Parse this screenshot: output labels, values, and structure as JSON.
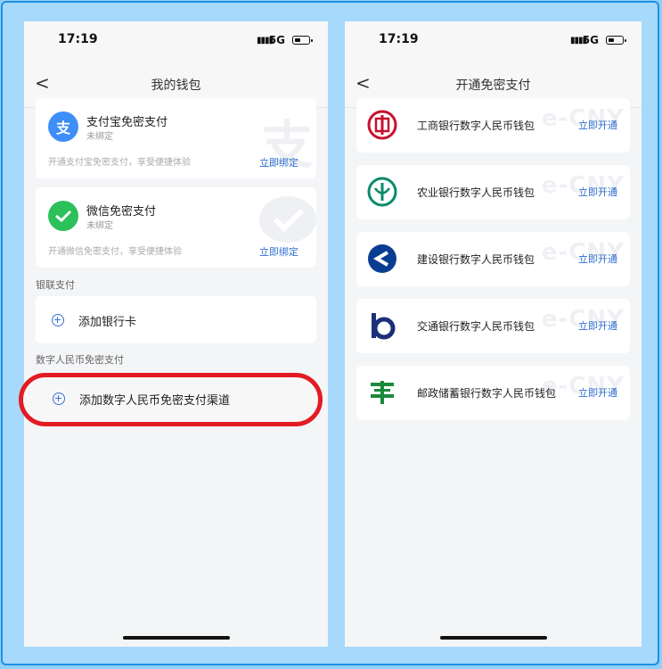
{
  "left": {
    "status": {
      "time": "17:19",
      "network": "5G"
    },
    "nav": {
      "back": "<",
      "title": "我的钱包"
    },
    "alipay": {
      "title": "支付宝免密支付",
      "status": "未绑定",
      "desc": "开通支付宝免密支付，享受便捷体验",
      "link": "立即绑定",
      "icon_char": "支",
      "watermark": "支"
    },
    "wechat": {
      "title": "微信免密支付",
      "status": "未绑定",
      "desc": "开通微信免密支付，享受便捷体验",
      "link": "立即绑定"
    },
    "unionpay_section": "银联支付",
    "add_card": "添加银行卡",
    "ecny_section": "数字人民币免密支付",
    "add_ecny": "添加数字人民币免密支付渠道"
  },
  "right": {
    "status": {
      "time": "17:19",
      "network": "5G"
    },
    "nav": {
      "back": "<",
      "title": "开通免密支付"
    },
    "watermark": "e-CNY",
    "banks": [
      {
        "name": "工商银行数字人民币钱包",
        "link": "立即开通",
        "logo": "icbc-logo",
        "color": "#c8102e"
      },
      {
        "name": "农业银行数字人民币钱包",
        "link": "立即开通",
        "logo": "abc-logo",
        "color": "#0a8a6a"
      },
      {
        "name": "建设银行数字人民币钱包",
        "link": "立即开通",
        "logo": "ccb-logo",
        "color": "#0a3d91"
      },
      {
        "name": "交通银行数字人民币钱包",
        "link": "立即开通",
        "logo": "bocom-logo",
        "color": "#1b2f7a"
      },
      {
        "name": "邮政储蓄银行数字人民币钱包",
        "link": "立即开通",
        "logo": "psbc-logo",
        "color": "#1a8a3a"
      }
    ]
  },
  "colors": {
    "accent": "#2f6fd0",
    "highlight": "#e31b23",
    "alipay": "#3e8ef7",
    "wechat": "#2cc15a"
  }
}
